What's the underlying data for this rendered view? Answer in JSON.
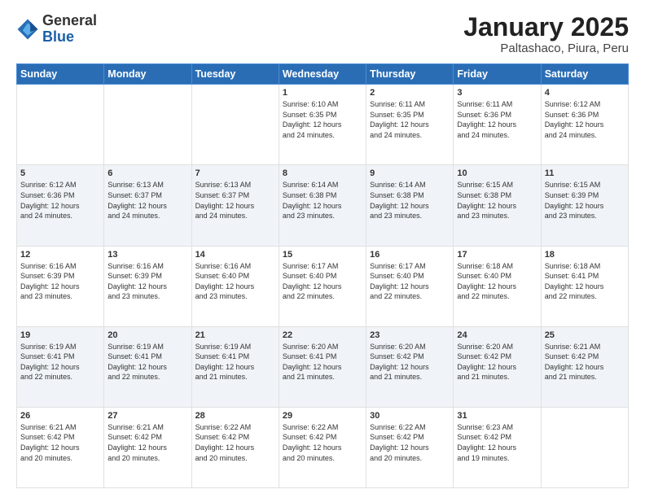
{
  "logo": {
    "general": "General",
    "blue": "Blue"
  },
  "title": "January 2025",
  "subtitle": "Paltashaco, Piura, Peru",
  "weekdays": [
    "Sunday",
    "Monday",
    "Tuesday",
    "Wednesday",
    "Thursday",
    "Friday",
    "Saturday"
  ],
  "weeks": [
    [
      {
        "day": "",
        "info": ""
      },
      {
        "day": "",
        "info": ""
      },
      {
        "day": "",
        "info": ""
      },
      {
        "day": "1",
        "info": "Sunrise: 6:10 AM\nSunset: 6:35 PM\nDaylight: 12 hours\nand 24 minutes."
      },
      {
        "day": "2",
        "info": "Sunrise: 6:11 AM\nSunset: 6:35 PM\nDaylight: 12 hours\nand 24 minutes."
      },
      {
        "day": "3",
        "info": "Sunrise: 6:11 AM\nSunset: 6:36 PM\nDaylight: 12 hours\nand 24 minutes."
      },
      {
        "day": "4",
        "info": "Sunrise: 6:12 AM\nSunset: 6:36 PM\nDaylight: 12 hours\nand 24 minutes."
      }
    ],
    [
      {
        "day": "5",
        "info": "Sunrise: 6:12 AM\nSunset: 6:36 PM\nDaylight: 12 hours\nand 24 minutes."
      },
      {
        "day": "6",
        "info": "Sunrise: 6:13 AM\nSunset: 6:37 PM\nDaylight: 12 hours\nand 24 minutes."
      },
      {
        "day": "7",
        "info": "Sunrise: 6:13 AM\nSunset: 6:37 PM\nDaylight: 12 hours\nand 24 minutes."
      },
      {
        "day": "8",
        "info": "Sunrise: 6:14 AM\nSunset: 6:38 PM\nDaylight: 12 hours\nand 23 minutes."
      },
      {
        "day": "9",
        "info": "Sunrise: 6:14 AM\nSunset: 6:38 PM\nDaylight: 12 hours\nand 23 minutes."
      },
      {
        "day": "10",
        "info": "Sunrise: 6:15 AM\nSunset: 6:38 PM\nDaylight: 12 hours\nand 23 minutes."
      },
      {
        "day": "11",
        "info": "Sunrise: 6:15 AM\nSunset: 6:39 PM\nDaylight: 12 hours\nand 23 minutes."
      }
    ],
    [
      {
        "day": "12",
        "info": "Sunrise: 6:16 AM\nSunset: 6:39 PM\nDaylight: 12 hours\nand 23 minutes."
      },
      {
        "day": "13",
        "info": "Sunrise: 6:16 AM\nSunset: 6:39 PM\nDaylight: 12 hours\nand 23 minutes."
      },
      {
        "day": "14",
        "info": "Sunrise: 6:16 AM\nSunset: 6:40 PM\nDaylight: 12 hours\nand 23 minutes."
      },
      {
        "day": "15",
        "info": "Sunrise: 6:17 AM\nSunset: 6:40 PM\nDaylight: 12 hours\nand 22 minutes."
      },
      {
        "day": "16",
        "info": "Sunrise: 6:17 AM\nSunset: 6:40 PM\nDaylight: 12 hours\nand 22 minutes."
      },
      {
        "day": "17",
        "info": "Sunrise: 6:18 AM\nSunset: 6:40 PM\nDaylight: 12 hours\nand 22 minutes."
      },
      {
        "day": "18",
        "info": "Sunrise: 6:18 AM\nSunset: 6:41 PM\nDaylight: 12 hours\nand 22 minutes."
      }
    ],
    [
      {
        "day": "19",
        "info": "Sunrise: 6:19 AM\nSunset: 6:41 PM\nDaylight: 12 hours\nand 22 minutes."
      },
      {
        "day": "20",
        "info": "Sunrise: 6:19 AM\nSunset: 6:41 PM\nDaylight: 12 hours\nand 22 minutes."
      },
      {
        "day": "21",
        "info": "Sunrise: 6:19 AM\nSunset: 6:41 PM\nDaylight: 12 hours\nand 21 minutes."
      },
      {
        "day": "22",
        "info": "Sunrise: 6:20 AM\nSunset: 6:41 PM\nDaylight: 12 hours\nand 21 minutes."
      },
      {
        "day": "23",
        "info": "Sunrise: 6:20 AM\nSunset: 6:42 PM\nDaylight: 12 hours\nand 21 minutes."
      },
      {
        "day": "24",
        "info": "Sunrise: 6:20 AM\nSunset: 6:42 PM\nDaylight: 12 hours\nand 21 minutes."
      },
      {
        "day": "25",
        "info": "Sunrise: 6:21 AM\nSunset: 6:42 PM\nDaylight: 12 hours\nand 21 minutes."
      }
    ],
    [
      {
        "day": "26",
        "info": "Sunrise: 6:21 AM\nSunset: 6:42 PM\nDaylight: 12 hours\nand 20 minutes."
      },
      {
        "day": "27",
        "info": "Sunrise: 6:21 AM\nSunset: 6:42 PM\nDaylight: 12 hours\nand 20 minutes."
      },
      {
        "day": "28",
        "info": "Sunrise: 6:22 AM\nSunset: 6:42 PM\nDaylight: 12 hours\nand 20 minutes."
      },
      {
        "day": "29",
        "info": "Sunrise: 6:22 AM\nSunset: 6:42 PM\nDaylight: 12 hours\nand 20 minutes."
      },
      {
        "day": "30",
        "info": "Sunrise: 6:22 AM\nSunset: 6:42 PM\nDaylight: 12 hours\nand 20 minutes."
      },
      {
        "day": "31",
        "info": "Sunrise: 6:23 AM\nSunset: 6:42 PM\nDaylight: 12 hours\nand 19 minutes."
      },
      {
        "day": "",
        "info": ""
      }
    ]
  ]
}
